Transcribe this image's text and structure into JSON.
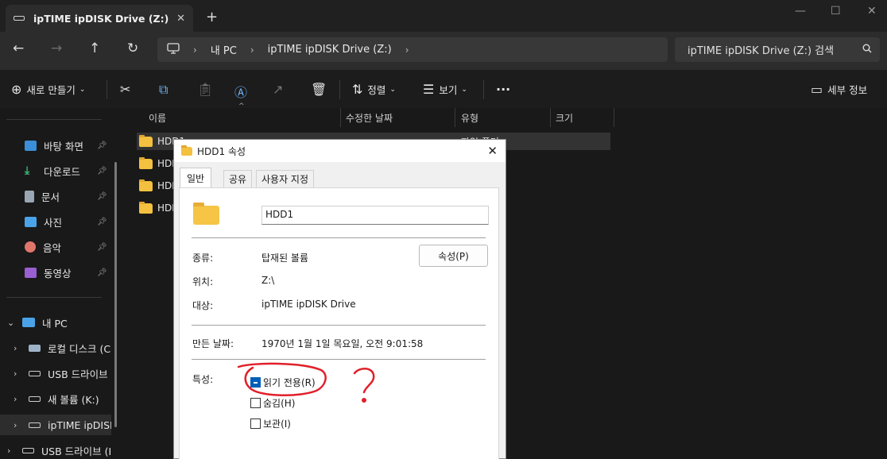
{
  "window": {
    "tab_title": "ipTIME ipDISK Drive (Z:)",
    "new_tab": "+",
    "close": "✕"
  },
  "nav": {
    "breadcrumb": [
      "내 PC",
      "ipTIME ipDISK Drive (Z:)"
    ],
    "search_placeholder": "ipTIME ipDISK Drive (Z:) 검색"
  },
  "commands": {
    "new": "새로 만들기",
    "sort": "정렬",
    "view": "보기",
    "more": "···",
    "details": "세부 정보"
  },
  "sidebar": {
    "quick": [
      {
        "label": "바탕 화면",
        "icon": "desktop-icon",
        "color": "#3a8fd8"
      },
      {
        "label": "다운로드",
        "icon": "download-icon",
        "color": "#3ab878"
      },
      {
        "label": "문서",
        "icon": "document-icon",
        "color": "#9aa6b4"
      },
      {
        "label": "사진",
        "icon": "pictures-icon",
        "color": "#4aa3e8"
      },
      {
        "label": "음악",
        "icon": "music-icon",
        "color": "#e0766a"
      },
      {
        "label": "동영상",
        "icon": "video-icon",
        "color": "#9a5fd0"
      }
    ],
    "this_pc": "내 PC",
    "drives": [
      "로컬 디스크 (C",
      "USB 드라이브",
      "새 볼륨 (K:)",
      "ipTIME ipDISK",
      "USB 드라이브 (I"
    ]
  },
  "list": {
    "columns": [
      "이름",
      "수정한 날짜",
      "유형",
      "크기"
    ],
    "rows": [
      "HDD1",
      "HDD",
      "HDD",
      "HDD"
    ],
    "selected_type": "파일 폴더"
  },
  "dialog": {
    "title": "HDD1 속성",
    "tabs": [
      "일반",
      "공유",
      "사용자 지정"
    ],
    "name": "HDD1",
    "type_label": "종류:",
    "type_value": "탑재된 볼륨",
    "location_label": "위치:",
    "location_value": "Z:\\",
    "target_label": "대상:",
    "target_value": "ipTIME ipDISK Drive",
    "created_label": "만든 날짜:",
    "created_value": "1970년 1월 1일 목요일, 오전 9:01:58",
    "attributes_label": "특성:",
    "properties_button": "속성(P)",
    "readonly": "읽기 전용(R)",
    "hidden": "숨김(H)",
    "archive": "보관(I)"
  },
  "annotation": {
    "color": "#e0202a",
    "mark": "?"
  }
}
